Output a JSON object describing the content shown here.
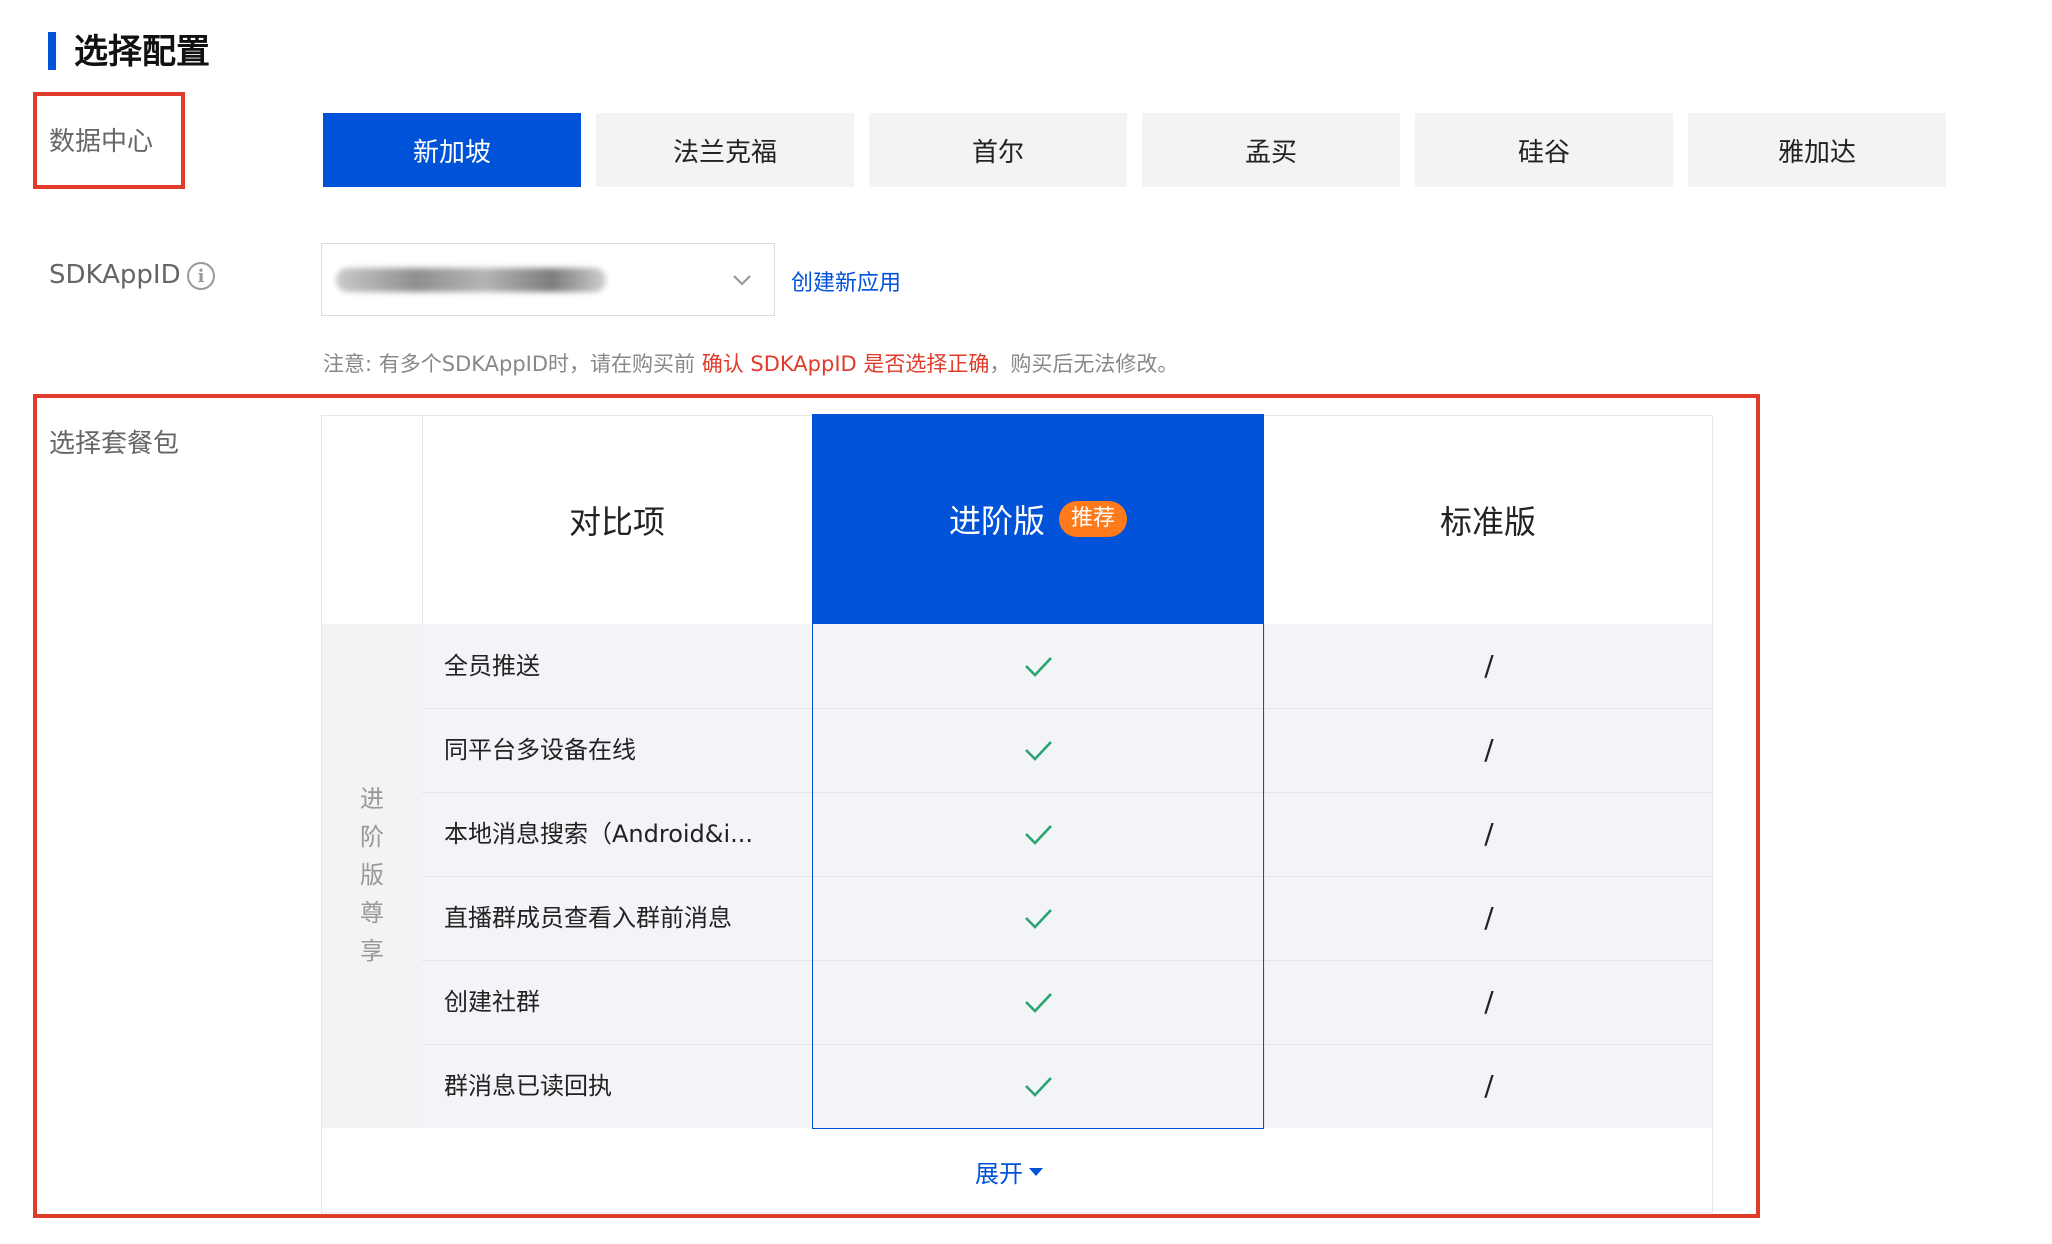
{
  "section_title": "选择配置",
  "datacenter": {
    "label": "数据中心",
    "regions": [
      "新加坡",
      "法兰克福",
      "首尔",
      "孟买",
      "硅谷",
      "雅加达"
    ],
    "selected": "新加坡"
  },
  "sdkappid": {
    "label": "SDKAppID",
    "create_link": "创建新应用",
    "note_prefix": "注意: 有多个SDKAppID时，请在购买前 ",
    "note_highlight": "确认 SDKAppID 是否选择正确",
    "note_suffix": "，购买后无法修改。"
  },
  "package": {
    "label": "选择套餐包",
    "col_compare": "对比项",
    "col_advanced": "进阶版",
    "badge": "推荐",
    "col_standard": "标准版",
    "group_label": "进阶版尊享",
    "rows": [
      {
        "name": "全员推送",
        "advanced": "✓",
        "standard": "/"
      },
      {
        "name": "同平台多设备在线",
        "advanced": "✓",
        "standard": "/"
      },
      {
        "name": "本地消息搜索（Android&i...",
        "advanced": "✓",
        "standard": "/"
      },
      {
        "name": "直播群成员查看入群前消息",
        "advanced": "✓",
        "standard": "/"
      },
      {
        "name": "创建社群",
        "advanced": "✓",
        "standard": "/"
      },
      {
        "name": "群消息已读回执",
        "advanced": "✓",
        "standard": "/"
      }
    ],
    "expand": "展开"
  },
  "colors": {
    "primary": "#0052d9",
    "highlight_red": "#e03b2b",
    "badge_orange": "#ff7a1a",
    "check_green": "#2ba471"
  }
}
